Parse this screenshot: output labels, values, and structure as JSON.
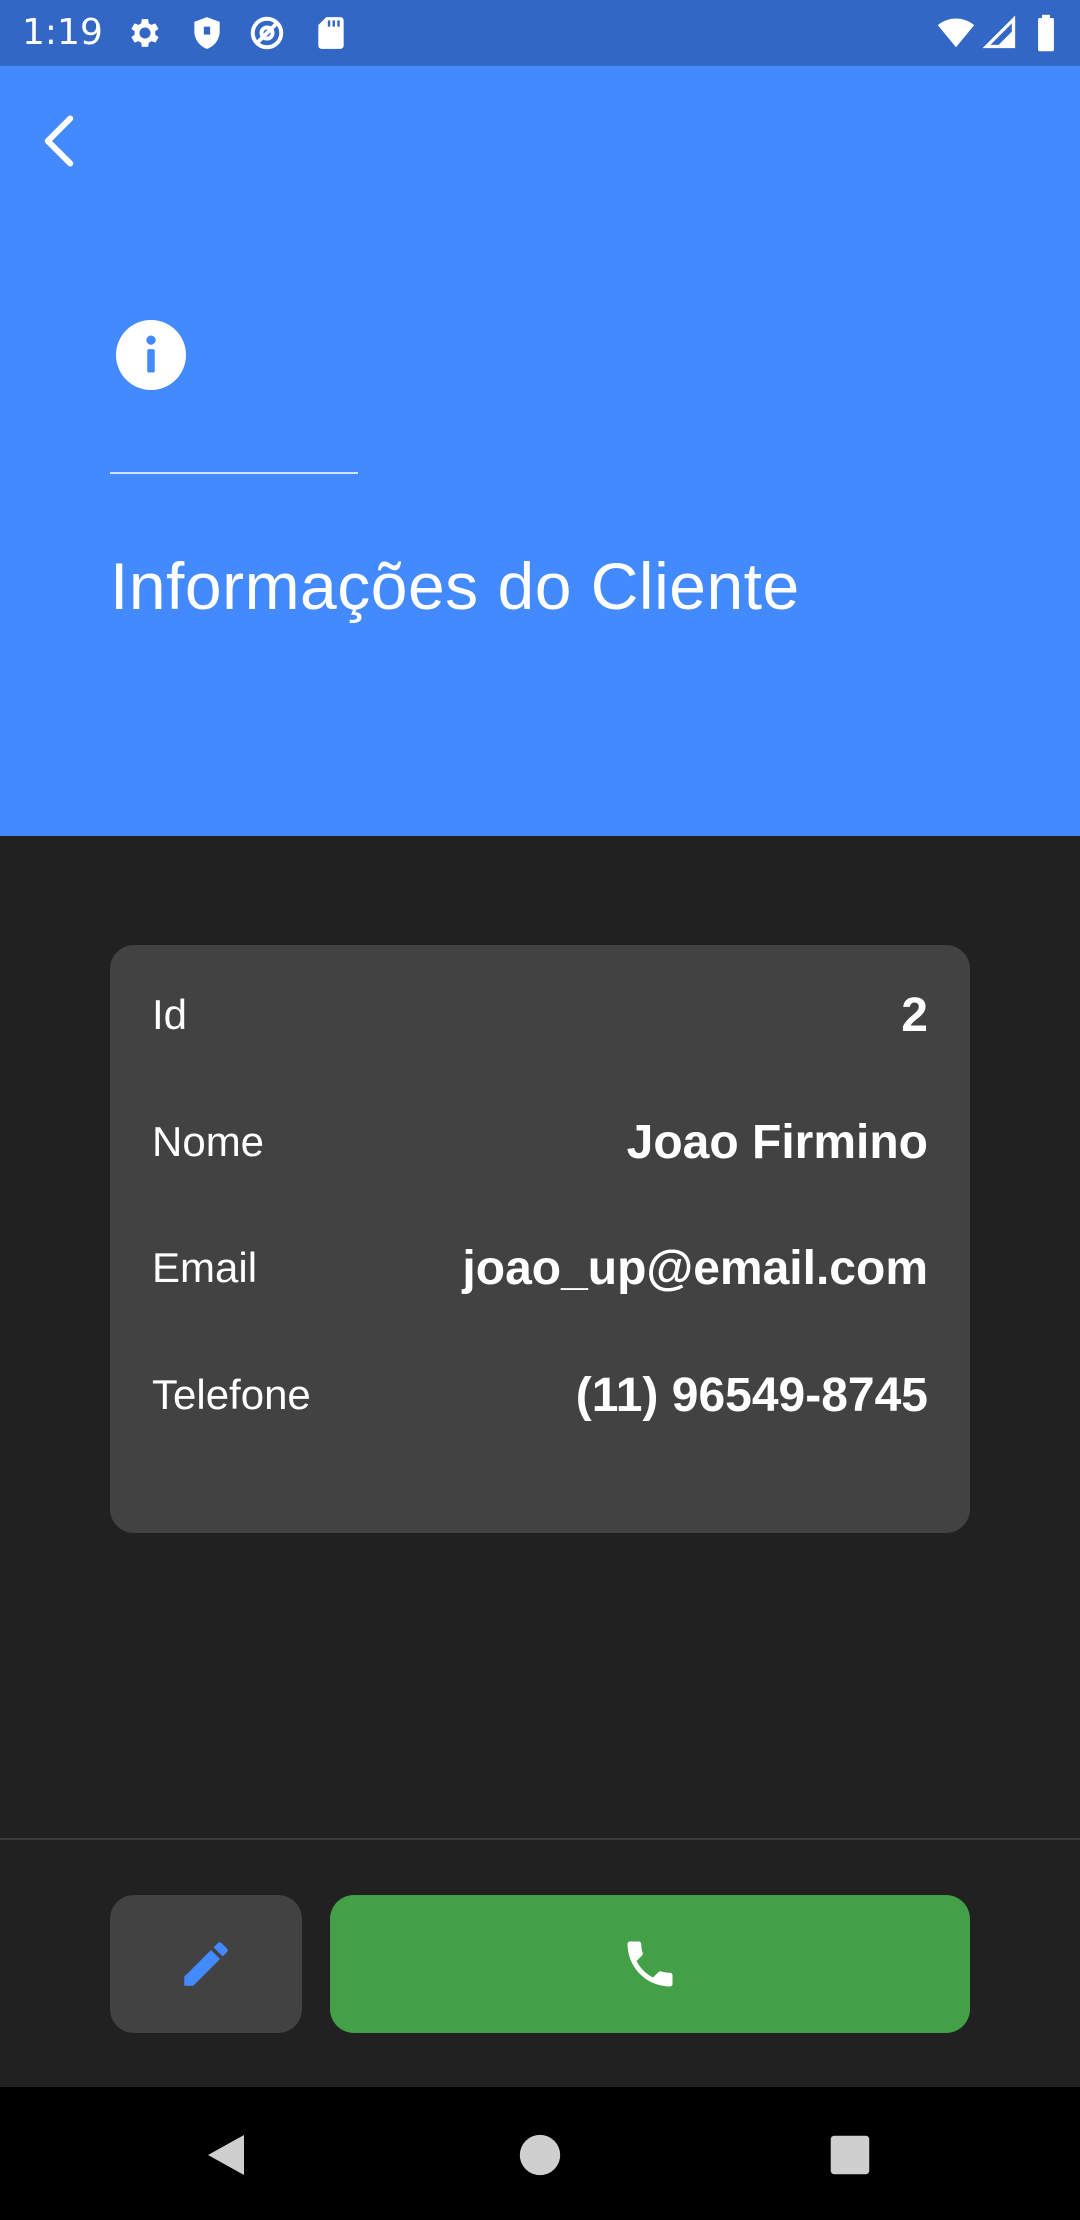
{
  "status_bar": {
    "time": "1:19",
    "left_icons": [
      "settings-gear-icon",
      "shield-icon",
      "at-sign-icon",
      "sd-card-icon"
    ],
    "right_icons": [
      "wifi-icon",
      "signal-icon",
      "battery-icon"
    ]
  },
  "header": {
    "back_icon": "chevron-left-icon",
    "info_icon": "info-circle-icon",
    "title": "Informações do Cliente",
    "background_color": "#448aff"
  },
  "client": {
    "rows": [
      {
        "label": "Id",
        "value": "2"
      },
      {
        "label": "Nome",
        "value": "Joao Firmino"
      },
      {
        "label": "Email",
        "value": "joao_up@email.com"
      },
      {
        "label": "Telefone",
        "value": "(11) 96549-8745"
      }
    ]
  },
  "actions": {
    "edit_icon": "pencil-icon",
    "edit_icon_color": "#448aff",
    "call_icon": "phone-icon",
    "call_color": "#43a047"
  },
  "nav_bar": {
    "icons": [
      "back-triangle-icon",
      "home-circle-icon",
      "recents-square-icon"
    ]
  }
}
